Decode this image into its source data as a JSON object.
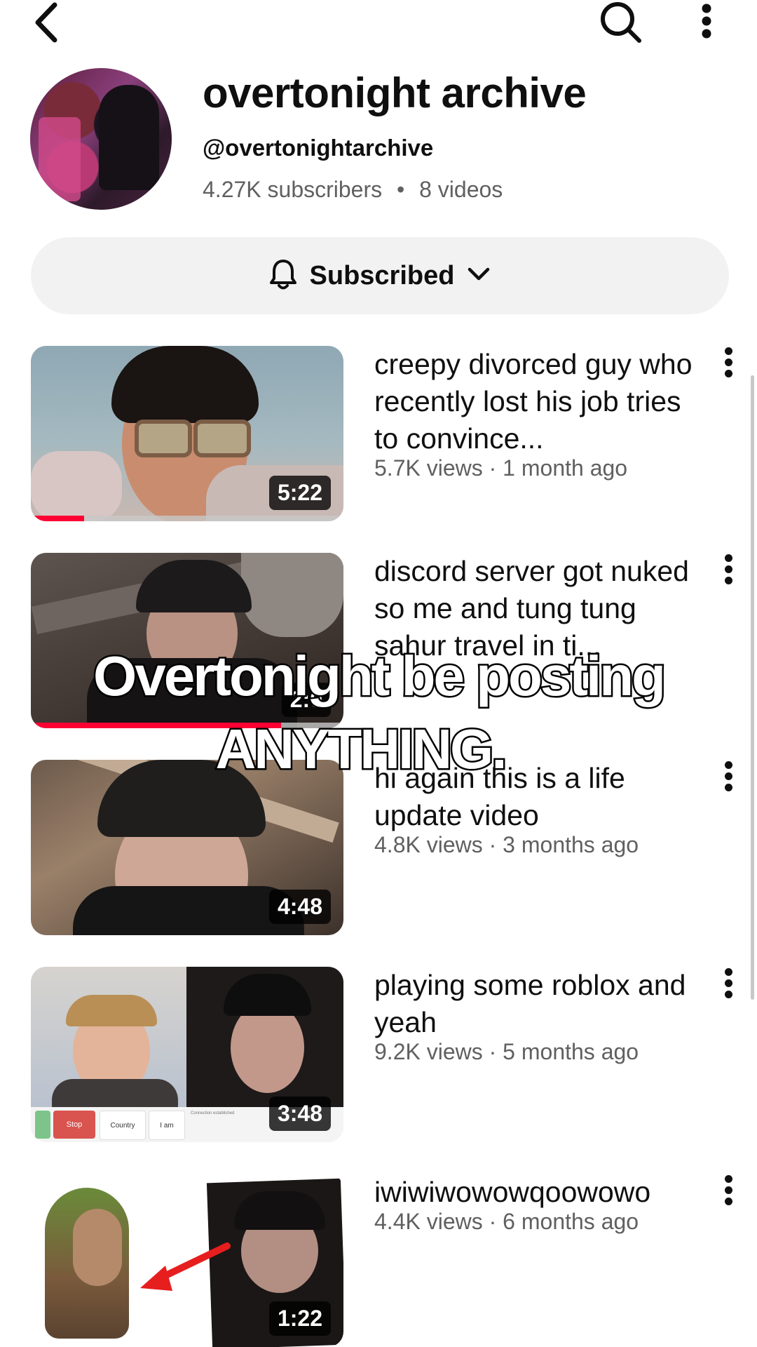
{
  "channel": {
    "name": "overtonight archive",
    "handle": "@overtonightarchive",
    "subscribers": "4.27K subscribers",
    "separator": "•",
    "video_count": "8 videos"
  },
  "subscribe_button": {
    "label": "Subscribed"
  },
  "icons": {
    "back": "back-arrow-icon",
    "search": "search-icon",
    "more": "more-vert-icon",
    "bell": "bell-icon",
    "chevron": "chevron-down-icon"
  },
  "videos": [
    {
      "title": "creepy divorced guy who recently lost his job tries to convince...",
      "meta": "5.7K views · 1 month ago",
      "duration": "5:22",
      "watched_fraction": 0.17
    },
    {
      "title": "discord server got nuked so me and tung tung sahur travel in ti...",
      "meta": "",
      "duration": "2:0",
      "watched_fraction": 0.8
    },
    {
      "title": "hi again this is a life update video",
      "meta": "4.8K views · 3 months ago",
      "duration": "4:48",
      "watched_fraction": 0
    },
    {
      "title": "playing some roblox and yeah",
      "meta": "9.2K views · 5 months ago",
      "duration": "3:48",
      "watched_fraction": 0
    },
    {
      "title": "iwiwiwowowqoowowo",
      "meta": "4.4K views · 6 months ago",
      "duration": "1:22",
      "watched_fraction": 0
    }
  ],
  "thumbnail_text": {
    "stop": "Stop",
    "country": "Country",
    "iam": "I am",
    "status": "Connection established"
  },
  "overlay_caption": {
    "line1": "Overtonight be posting",
    "line2": "ANYTHING."
  },
  "colors": {
    "accent": "#ff0033",
    "meta_gray": "#606060",
    "pill_bg": "#f2f2f2"
  }
}
